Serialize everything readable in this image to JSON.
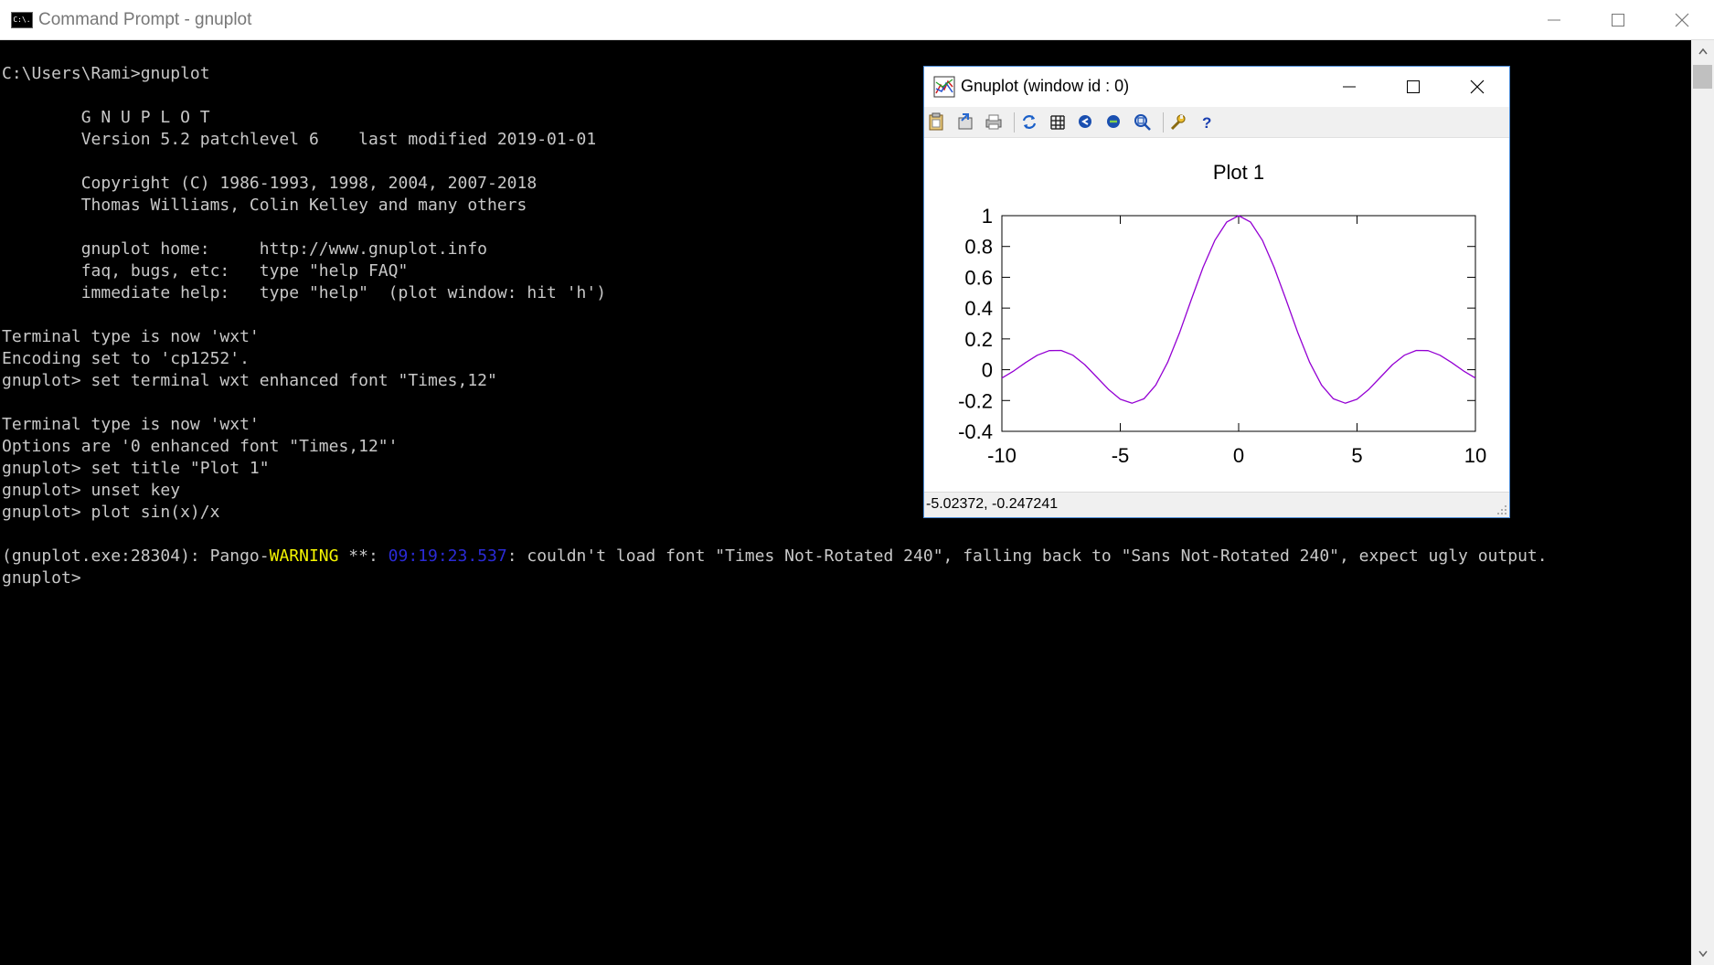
{
  "cmd_window": {
    "title": "Command Prompt - gnuplot",
    "icon": "cmd-icon",
    "icon_text": "C:\\."
  },
  "console": {
    "lines": [
      [
        {
          "t": "C:\\Users\\Rami>gnuplot"
        }
      ],
      [
        {
          "t": ""
        }
      ],
      [
        {
          "t": "        G N U P L O T"
        }
      ],
      [
        {
          "t": "        Version 5.2 patchlevel 6    last modified 2019-01-01"
        }
      ],
      [
        {
          "t": ""
        }
      ],
      [
        {
          "t": "        Copyright (C) 1986-1993, 1998, 2004, 2007-2018"
        }
      ],
      [
        {
          "t": "        Thomas Williams, Colin Kelley and many others"
        }
      ],
      [
        {
          "t": ""
        }
      ],
      [
        {
          "t": "        gnuplot home:     http://www.gnuplot.info"
        }
      ],
      [
        {
          "t": "        faq, bugs, etc:   type \"help FAQ\""
        }
      ],
      [
        {
          "t": "        immediate help:   type \"help\"  (plot window: hit 'h')"
        }
      ],
      [
        {
          "t": ""
        }
      ],
      [
        {
          "t": "Terminal type is now 'wxt'"
        }
      ],
      [
        {
          "t": "Encoding set to 'cp1252'."
        }
      ],
      [
        {
          "t": "gnuplot> set terminal wxt enhanced font \"Times,12\""
        }
      ],
      [
        {
          "t": ""
        }
      ],
      [
        {
          "t": "Terminal type is now 'wxt'"
        }
      ],
      [
        {
          "t": "Options are '0 enhanced font \"Times,12\"'"
        }
      ],
      [
        {
          "t": "gnuplot> set title \"Plot 1\""
        }
      ],
      [
        {
          "t": "gnuplot> unset key"
        }
      ],
      [
        {
          "t": "gnuplot> plot sin(x)/x"
        }
      ],
      [
        {
          "t": ""
        }
      ],
      [
        {
          "t": "(gnuplot.exe:28304): Pango-"
        },
        {
          "t": "WARNING",
          "c": "warn"
        },
        {
          "t": " **: "
        },
        {
          "t": "09:19:23.537",
          "c": "ts"
        },
        {
          "t": ": couldn't load font \"Times Not-Rotated 240\", falling back to \"Sans Not-Rotated 240\", expect ugly output."
        }
      ],
      [
        {
          "t": "gnuplot>"
        }
      ]
    ]
  },
  "gnuplot_window": {
    "title": "Gnuplot (window id : 0)",
    "toolbar": [
      {
        "name": "copy-to-clipboard-icon"
      },
      {
        "name": "export-icon"
      },
      {
        "name": "print-icon"
      },
      {
        "name": "sep"
      },
      {
        "name": "replot-icon"
      },
      {
        "name": "toggle-grid-icon"
      },
      {
        "name": "zoom-previous-icon"
      },
      {
        "name": "zoom-next-icon"
      },
      {
        "name": "autoscale-icon"
      },
      {
        "name": "sep"
      },
      {
        "name": "configuration-icon"
      },
      {
        "name": "help-icon"
      }
    ],
    "status": "-5.02372, -0.247241"
  },
  "chart_data": {
    "type": "line",
    "title": "Plot 1",
    "function": "sin(x)/x",
    "xlim": [
      -10,
      10
    ],
    "ylim": [
      -0.4,
      1
    ],
    "xticks": [
      -10,
      -5,
      0,
      5,
      10
    ],
    "yticks": [
      -0.4,
      -0.2,
      0,
      0.2,
      0.4,
      0.6,
      0.8,
      1
    ],
    "ytick_labels": [
      "-0.4",
      "-0.2",
      "0",
      "0.2",
      "0.4",
      "0.6",
      "0.8",
      "1"
    ],
    "xtick_labels": [
      "-10",
      "-5",
      "0",
      "5",
      "10"
    ],
    "legend": "none",
    "grid": false,
    "series": [
      {
        "color": "#9400d3",
        "x": [
          -10,
          -9.5,
          -9,
          -8.5,
          -8,
          -7.5,
          -7,
          -6.5,
          -6,
          -5.5,
          -5,
          -4.5,
          -4,
          -3.5,
          -3,
          -2.5,
          -2,
          -1.5,
          -1,
          -0.5,
          0,
          0.5,
          1,
          1.5,
          2,
          2.5,
          3,
          3.5,
          4,
          4.5,
          5,
          5.5,
          6,
          6.5,
          7,
          7.5,
          8,
          8.5,
          9,
          9.5,
          10
        ],
        "y": [
          -0.054,
          -0.008,
          0.046,
          0.094,
          0.124,
          0.125,
          0.094,
          0.033,
          -0.047,
          -0.128,
          -0.192,
          -0.217,
          -0.189,
          -0.1,
          0.047,
          0.239,
          0.455,
          0.665,
          0.841,
          0.959,
          1,
          0.959,
          0.841,
          0.665,
          0.455,
          0.239,
          0.047,
          -0.1,
          -0.189,
          -0.217,
          -0.192,
          -0.128,
          -0.047,
          0.033,
          0.094,
          0.125,
          0.124,
          0.094,
          0.046,
          -0.008,
          -0.054
        ]
      }
    ]
  }
}
